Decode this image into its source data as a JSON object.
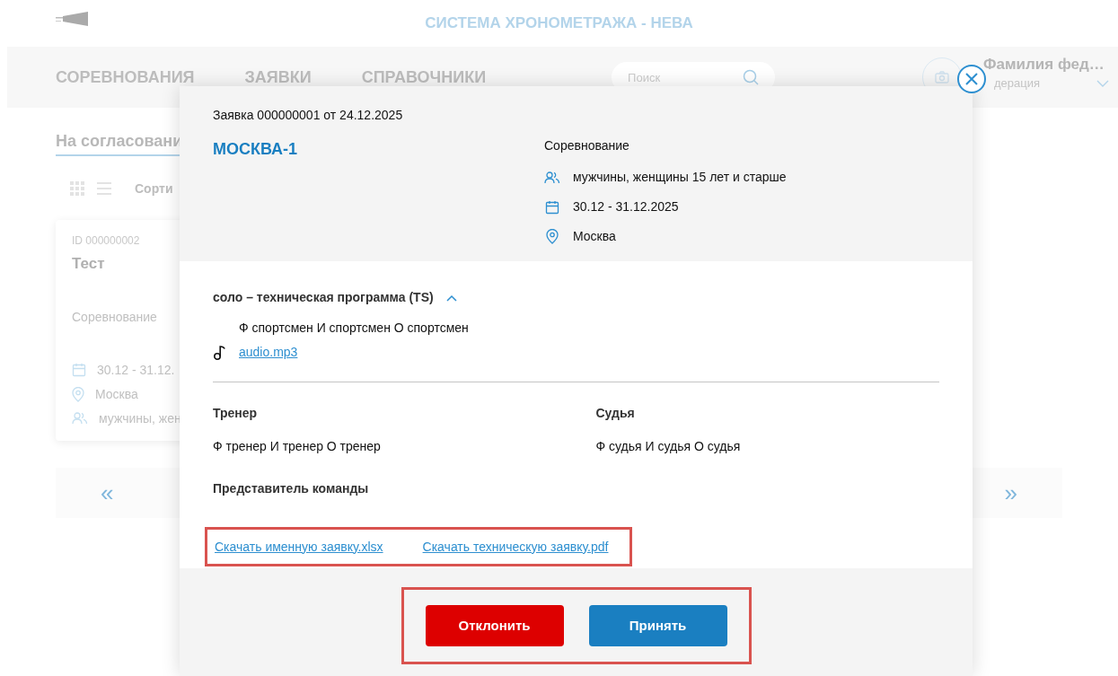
{
  "header": {
    "title": "СИСТЕМА ХРОНОМЕТРАЖА - НЕВА"
  },
  "nav": {
    "items": [
      {
        "label": "СОРЕВНОВАНИЯ"
      },
      {
        "label": "ЗАЯВКИ"
      },
      {
        "label": "СПРАВОЧНИКИ"
      }
    ]
  },
  "search": {
    "placeholder": "Поиск"
  },
  "user": {
    "name": "Фамилия фед…",
    "role": "дерация"
  },
  "status_tabs": [
    {
      "label": "На согласовани",
      "selected": true
    }
  ],
  "sort": {
    "label": "Сорти"
  },
  "card": {
    "id": "ID 000000002",
    "title": "Тест",
    "type": "Соревнование",
    "dates": "30.12 - 31.12.",
    "city": "Москва",
    "audience": "мужчины, жен"
  },
  "pagination": {
    "prev": "«",
    "next": "»"
  },
  "modal": {
    "heading": "Заявка 000000001 от 24.12.2025",
    "team": "МОСКВА-1",
    "competition": {
      "label": "Соревнование",
      "audience": "мужчины, женщины 15 лет и старше",
      "dates": "30.12 - 31.12.2025",
      "city": "Москва"
    },
    "discipline": {
      "title": "соло – техническая программа (TS)",
      "expanded": true,
      "athletes": "Ф спортсмен И спортсмен О спортсмен",
      "audio": "audio.mp3"
    },
    "coach_label": "Тренер",
    "coach": "Ф тренер И тренер О тренер",
    "judge_label": "Судья",
    "judge": "Ф судья И судья О судья",
    "rep_label": "Представитель команды",
    "downloads": [
      "Скачать именную заявку.xlsx",
      "Скачать техническую заявку.pdf"
    ],
    "buttons": [
      {
        "label": "Отклонить",
        "kind": "reject"
      },
      {
        "label": "Принять",
        "kind": "accept"
      }
    ]
  }
}
